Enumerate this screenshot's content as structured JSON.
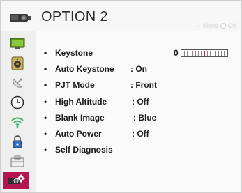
{
  "header": {
    "title": "OPTION 2",
    "hint_move": "Move",
    "hint_ok": "OK",
    "icon": "projector-icon"
  },
  "sidebar": {
    "items": [
      {
        "name": "picture-icon",
        "active": false
      },
      {
        "name": "audio-icon",
        "active": false
      },
      {
        "name": "satellite-icon",
        "active": false
      },
      {
        "name": "clock-icon",
        "active": false
      },
      {
        "name": "network-icon",
        "active": false
      },
      {
        "name": "lock-icon",
        "active": false
      },
      {
        "name": "option-icon",
        "active": false
      },
      {
        "name": "projector-settings-icon",
        "active": true
      }
    ]
  },
  "menu": {
    "bullet": "•",
    "items": [
      {
        "label": "Keystone",
        "value": "0"
      },
      {
        "label": "Auto Keystone",
        "value": ": On"
      },
      {
        "label": "PJT Mode",
        "value": ": Front"
      },
      {
        "label": "High Altitude",
        "value": ": Off"
      },
      {
        "label": "Blank Image",
        "value": ": Blue"
      },
      {
        "label": "Auto Power",
        "value": ": Off"
      },
      {
        "label": "Self Diagnosis",
        "value": ""
      }
    ]
  },
  "colors": {
    "accent": "#b5154e",
    "indicator": "#d4183f"
  }
}
